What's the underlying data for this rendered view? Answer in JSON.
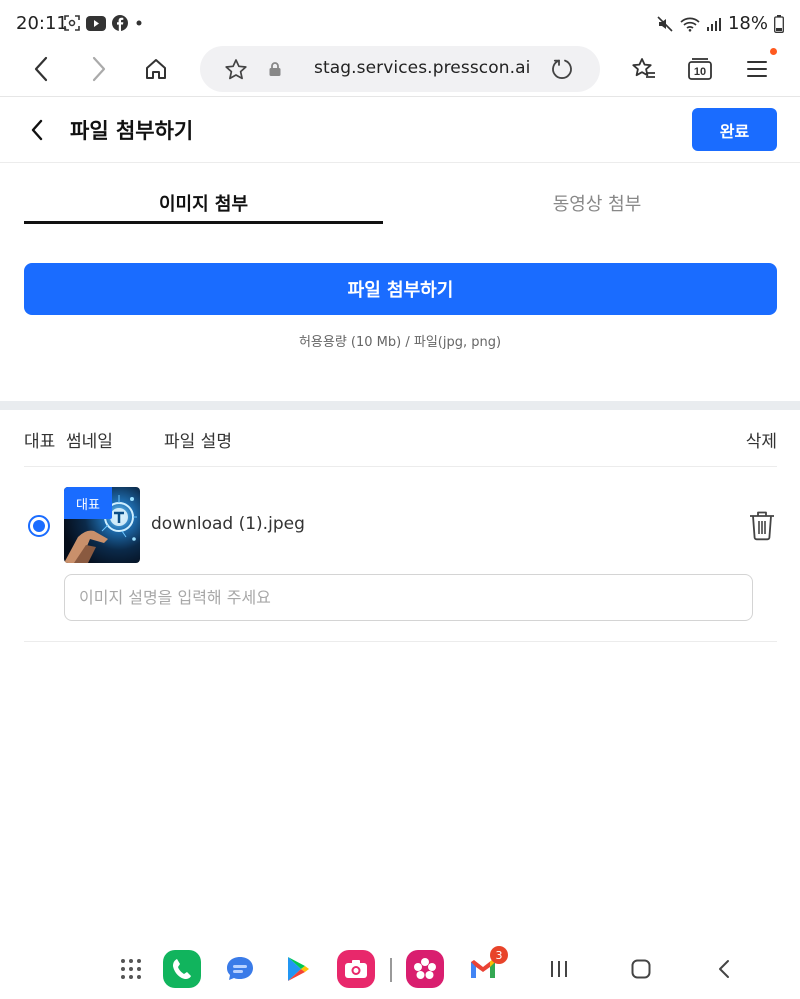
{
  "status_bar": {
    "time": "20:11",
    "battery": "18%",
    "icons": [
      "screen-record-icon",
      "youtube-icon",
      "facebook-icon",
      "notification-dot-icon",
      "mute-icon",
      "wifi-icon",
      "signal-icon",
      "battery-icon"
    ]
  },
  "browser": {
    "url": "stag.services.presscon.ai",
    "tab_count": "10"
  },
  "header": {
    "title": "파일 첨부하기",
    "done_label": "완료"
  },
  "tabs": [
    {
      "label": "이미지 첨부",
      "active": true
    },
    {
      "label": "동영상 첨부",
      "active": false
    }
  ],
  "attach": {
    "button_label": "파일 첨부하기",
    "capacity_note": "허용용량 (10 Mb) / 파일(jpg, png)"
  },
  "list": {
    "headers": {
      "representative": "대표",
      "thumbnail": "썸네일",
      "description": "파일 설명",
      "delete": "삭제"
    },
    "items": [
      {
        "badge": "대표",
        "filename": "download (1).jpeg",
        "selected": true,
        "description_value": "",
        "description_placeholder": "이미지 설명을 입력해 주세요"
      }
    ]
  },
  "dock": {
    "apps": [
      "app-drawer-icon",
      "phone-icon",
      "messages-icon",
      "play-store-icon",
      "camera-icon",
      "gallery-icon",
      "gmail-icon"
    ],
    "gmail_badge": "3",
    "nav": [
      "recent-apps-icon",
      "home-icon",
      "back-icon"
    ]
  },
  "colors": {
    "accent": "#1a6cff",
    "divider": "#ececec",
    "section_gap": "#e9ecef"
  }
}
